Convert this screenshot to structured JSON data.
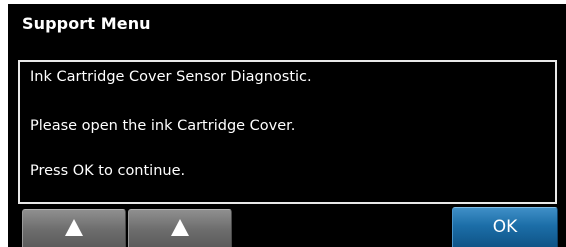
{
  "header": {
    "title": "Support Menu"
  },
  "message": {
    "lines": [
      "Ink Cartridge Cover Sensor Diagnostic.",
      "Please open the ink Cartridge Cover.",
      "Press OK to continue."
    ]
  },
  "buttons": {
    "up_icon": "up-triangle",
    "ok_label": "OK"
  },
  "colors": {
    "screen": "#000000",
    "ok_button": "#1c6ea8",
    "nav_button": "#7a7a7a",
    "text": "#ffffff"
  }
}
